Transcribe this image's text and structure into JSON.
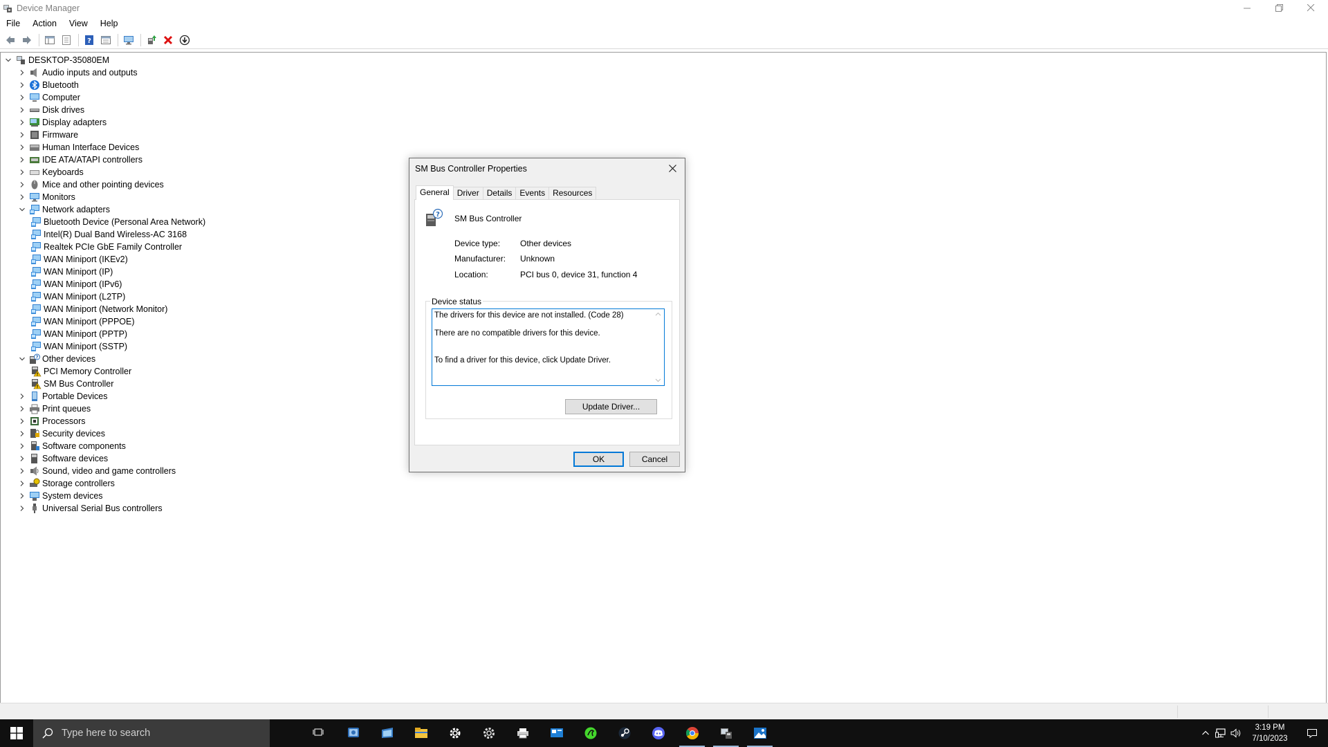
{
  "window": {
    "title": "Device Manager",
    "controls": [
      "minimize",
      "restore",
      "close"
    ]
  },
  "menu": [
    "File",
    "Action",
    "View",
    "Help"
  ],
  "toolbar_icons": [
    "back-icon",
    "forward-icon",
    "show-hide-console-tree-icon",
    "properties-icon",
    "help-icon",
    "view-icon",
    "monitor-icon",
    "update-driver-icon",
    "uninstall-device-icon",
    "scan-download-icon"
  ],
  "tree": {
    "root": "DESKTOP-35080EM",
    "items": [
      {
        "label": "Audio inputs and outputs",
        "level": 1,
        "expander": "collapsed",
        "icon": "speaker-icon"
      },
      {
        "label": "Bluetooth",
        "level": 1,
        "expander": "collapsed",
        "icon": "bluetooth-icon"
      },
      {
        "label": "Computer",
        "level": 1,
        "expander": "collapsed",
        "icon": "computer-icon"
      },
      {
        "label": "Disk drives",
        "level": 1,
        "expander": "collapsed",
        "icon": "disk-icon"
      },
      {
        "label": "Display adapters",
        "level": 1,
        "expander": "collapsed",
        "icon": "display-adapter-icon"
      },
      {
        "label": "Firmware",
        "level": 1,
        "expander": "collapsed",
        "icon": "firmware-icon"
      },
      {
        "label": "Human Interface Devices",
        "level": 1,
        "expander": "collapsed",
        "icon": "hid-icon"
      },
      {
        "label": "IDE ATA/ATAPI controllers",
        "level": 1,
        "expander": "collapsed",
        "icon": "ide-icon"
      },
      {
        "label": "Keyboards",
        "level": 1,
        "expander": "collapsed",
        "icon": "keyboard-icon"
      },
      {
        "label": "Mice and other pointing devices",
        "level": 1,
        "expander": "collapsed",
        "icon": "mouse-icon"
      },
      {
        "label": "Monitors",
        "level": 1,
        "expander": "collapsed",
        "icon": "monitor-icon"
      },
      {
        "label": "Network adapters",
        "level": 1,
        "expander": "expanded",
        "icon": "network-icon"
      },
      {
        "label": "Bluetooth Device (Personal Area Network)",
        "level": 2,
        "expander": "none",
        "icon": "network-icon"
      },
      {
        "label": "Intel(R) Dual Band Wireless-AC 3168",
        "level": 2,
        "expander": "none",
        "icon": "network-icon"
      },
      {
        "label": "Realtek PCIe GbE Family Controller",
        "level": 2,
        "expander": "none",
        "icon": "network-icon"
      },
      {
        "label": "WAN Miniport (IKEv2)",
        "level": 2,
        "expander": "none",
        "icon": "network-icon"
      },
      {
        "label": "WAN Miniport (IP)",
        "level": 2,
        "expander": "none",
        "icon": "network-icon"
      },
      {
        "label": "WAN Miniport (IPv6)",
        "level": 2,
        "expander": "none",
        "icon": "network-icon"
      },
      {
        "label": "WAN Miniport (L2TP)",
        "level": 2,
        "expander": "none",
        "icon": "network-icon"
      },
      {
        "label": "WAN Miniport (Network Monitor)",
        "level": 2,
        "expander": "none",
        "icon": "network-icon"
      },
      {
        "label": "WAN Miniport (PPPOE)",
        "level": 2,
        "expander": "none",
        "icon": "network-icon"
      },
      {
        "label": "WAN Miniport (PPTP)",
        "level": 2,
        "expander": "none",
        "icon": "network-icon"
      },
      {
        "label": "WAN Miniport (SSTP)",
        "level": 2,
        "expander": "none",
        "icon": "network-icon"
      },
      {
        "label": "Other devices",
        "level": 1,
        "expander": "expanded",
        "icon": "unknown-device-icon"
      },
      {
        "label": "PCI Memory Controller",
        "level": 2,
        "expander": "none",
        "icon": "warning-device-icon"
      },
      {
        "label": "SM Bus Controller",
        "level": 2,
        "expander": "none",
        "icon": "warning-device-icon"
      },
      {
        "label": "Portable Devices",
        "level": 1,
        "expander": "collapsed",
        "icon": "portable-device-icon"
      },
      {
        "label": "Print queues",
        "level": 1,
        "expander": "collapsed",
        "icon": "printer-icon"
      },
      {
        "label": "Processors",
        "level": 1,
        "expander": "collapsed",
        "icon": "processor-icon"
      },
      {
        "label": "Security devices",
        "level": 1,
        "expander": "collapsed",
        "icon": "security-device-icon"
      },
      {
        "label": "Software components",
        "level": 1,
        "expander": "collapsed",
        "icon": "software-component-icon"
      },
      {
        "label": "Software devices",
        "level": 1,
        "expander": "collapsed",
        "icon": "software-device-icon"
      },
      {
        "label": "Sound, video and game controllers",
        "level": 1,
        "expander": "collapsed",
        "icon": "sound-icon"
      },
      {
        "label": "Storage controllers",
        "level": 1,
        "expander": "collapsed",
        "icon": "storage-controller-icon"
      },
      {
        "label": "System devices",
        "level": 1,
        "expander": "collapsed",
        "icon": "system-device-icon"
      },
      {
        "label": "Universal Serial Bus controllers",
        "level": 1,
        "expander": "collapsed",
        "icon": "usb-icon"
      }
    ]
  },
  "dialog": {
    "title": "SM Bus Controller Properties",
    "tabs": [
      "General",
      "Driver",
      "Details",
      "Events",
      "Resources"
    ],
    "active_tab": "General",
    "device_name": "SM Bus Controller",
    "properties": [
      {
        "label": "Device type:",
        "value": "Other devices"
      },
      {
        "label": "Manufacturer:",
        "value": "Unknown"
      },
      {
        "label": "Location:",
        "value": "PCI bus 0, device 31, function 4"
      }
    ],
    "status_legend": "Device status",
    "status_lines": [
      "The drivers for this device are not installed. (Code 28)",
      "There are no compatible drivers for this device.",
      "To find a driver for this device, click Update Driver."
    ],
    "update_driver_label": "Update Driver...",
    "ok_label": "OK",
    "cancel_label": "Cancel"
  },
  "taskbar": {
    "search_placeholder": "Type here to search",
    "apps": [
      "task-view-icon",
      "app-blue-icon",
      "app-window-icon",
      "file-explorer-icon",
      "settings-icon",
      "settings-gear-icon",
      "app-printer-icon",
      "app-screen-icon",
      "razer-icon",
      "steam-icon",
      "discord-icon",
      "chrome-icon",
      "device-manager-icon",
      "photos-icon"
    ],
    "running": [
      11,
      12,
      13
    ],
    "time": "3:19 PM",
    "date": "7/10/2023"
  },
  "colors": {
    "accent": "#0078d7",
    "taskbar": "#101010",
    "search_box": "#3b3b3b",
    "dialog_bg": "#f0f0f0"
  }
}
